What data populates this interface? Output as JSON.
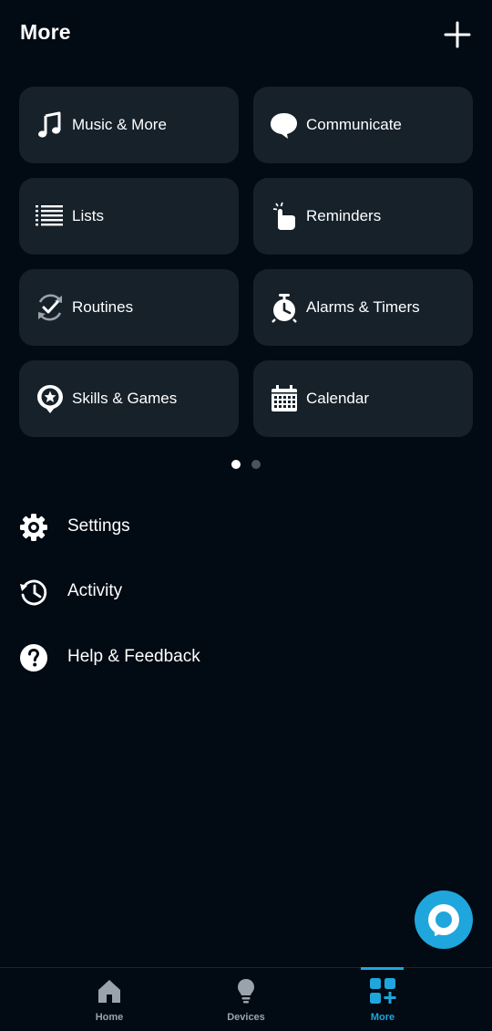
{
  "header": {
    "title": "More",
    "add_icon": "plus-icon"
  },
  "tiles": [
    {
      "label": "Music & More",
      "icon": "music-note-icon"
    },
    {
      "label": "Communicate",
      "icon": "speech-bubble-icon"
    },
    {
      "label": "Lists",
      "icon": "list-icon"
    },
    {
      "label": "Reminders",
      "icon": "hand-tap-icon"
    },
    {
      "label": "Routines",
      "icon": "routine-check-icon"
    },
    {
      "label": "Alarms & Timers",
      "icon": "alarm-clock-icon"
    },
    {
      "label": "Skills & Games",
      "icon": "star-pin-icon"
    },
    {
      "label": "Calendar",
      "icon": "calendar-icon"
    }
  ],
  "pager": {
    "pages": 2,
    "active": 1
  },
  "menu": [
    {
      "label": "Settings",
      "icon": "gear-icon"
    },
    {
      "label": "Activity",
      "icon": "history-icon"
    },
    {
      "label": "Help & Feedback",
      "icon": "question-icon"
    }
  ],
  "bottom_nav": {
    "items": [
      {
        "label": "Home",
        "icon": "home-icon",
        "active": false
      },
      {
        "label": "Devices",
        "icon": "lightbulb-icon",
        "active": false
      },
      {
        "label": "More",
        "icon": "grid-plus-icon",
        "active": true
      }
    ]
  },
  "fab": {
    "icon": "alexa-ring-icon"
  },
  "colors": {
    "background": "#020a13",
    "tile": "#16212a",
    "accent": "#1fa6dc",
    "inactive": "#9aa3ab",
    "text": "#ffffff"
  }
}
